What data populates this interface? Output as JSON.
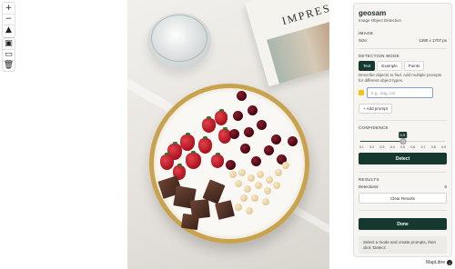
{
  "map_controls": {
    "zoom_in": "+",
    "zoom_out": "−",
    "compass": "▲",
    "bbox_tool": "▣",
    "rectangle_tool": "▭",
    "delete_tool": "🗑"
  },
  "photo": {
    "book_title": "IMPRES"
  },
  "panel": {
    "title": "geosam",
    "subtitle": "Image Object Detection",
    "image_section": "IMAGE",
    "size_label": "Size:",
    "size_value": "1280 x 1707 px",
    "detection_mode_section": "DETECTION MODE",
    "modes": [
      "Text",
      "Example",
      "Points"
    ],
    "active_mode": "Text",
    "mode_description": "Describe objects to find. Add multiple prompts for different object types.",
    "prompt_value": "",
    "prompt_placeholder": "e.g., dog, car",
    "prompt_color": "#f2c215",
    "add_prompt_label": "+ Add prompt",
    "confidence_section": "CONFIDENCE",
    "confidence_value": "0.5",
    "confidence_fraction": 0.5,
    "confidence_ticks": [
      "0.1",
      "0.2",
      "0.3",
      "0.4",
      "0.5",
      "0.6",
      "0.7",
      "0.8",
      "0.9"
    ],
    "detect_label": "Detect",
    "results_section": "RESULTS",
    "detections_label": "Detections:",
    "detections_value": "0",
    "clear_results_label": "Clear Results",
    "done_label": "Done",
    "status_message": "Select a mode and create prompts, then click 'Detect'."
  },
  "attribution": "MapLibre",
  "colors": {
    "primary": "#15382f",
    "panel_bg": "#f6f5f2"
  }
}
